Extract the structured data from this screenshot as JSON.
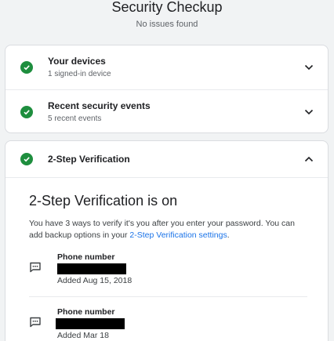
{
  "header": {
    "title": "Security Checkup",
    "subtitle": "No issues found"
  },
  "sections": {
    "devices": {
      "label": "Your devices",
      "sub": "1 signed-in device"
    },
    "events": {
      "label": "Recent security events",
      "sub": "5 recent events"
    },
    "tsv": {
      "label": "2-Step Verification"
    }
  },
  "tsv_panel": {
    "title": "2-Step Verification is on",
    "desc_prefix": "You have 3 ways to verify it's you after you enter your password. You can add backup options in your ",
    "desc_link": "2-Step Verification settings",
    "desc_suffix": ".",
    "methods": [
      {
        "label": "Phone number",
        "added": "Added Aug 15, 2018"
      },
      {
        "label": "Phone number",
        "added": "Added Mar 18"
      }
    ]
  },
  "colors": {
    "accent": "#1a73e8",
    "success": "#1e8e3e",
    "background": "#f1f3f4"
  },
  "icons": {
    "status": "check-circle-icon",
    "expand": "chevron-down-icon",
    "collapse": "chevron-up-icon",
    "method": "message-icon"
  }
}
